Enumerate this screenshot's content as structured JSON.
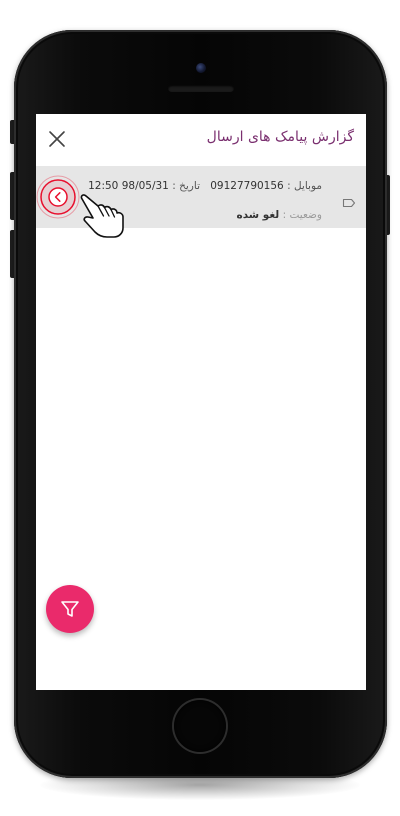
{
  "app": {
    "title": "گزارش پیامک های ارسال"
  },
  "record": {
    "mobile_label": "موبایل :",
    "mobile_value": "09127790156",
    "date_label": "تاریخ :",
    "date_value": "98/05/31",
    "time_value": "12:50",
    "status_label": "وضعیت :",
    "status_value": "لغو شده"
  },
  "icons": {
    "close": "close-icon",
    "tag": "tag-icon",
    "detail": "chevron-left-icon",
    "filter": "filter-icon",
    "hand": "hand-pointer-icon"
  },
  "colors": {
    "title": "#7a2f6f",
    "highlight": "#e8102e",
    "fab": "#ea2a6b",
    "row_background": "#e6e6e6"
  }
}
